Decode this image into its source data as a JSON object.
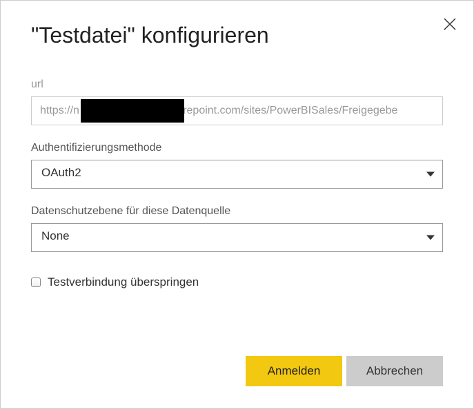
{
  "dialog": {
    "title": "\"Testdatei\" konfigurieren"
  },
  "fields": {
    "url": {
      "label": "url",
      "value": "https://n                            sharepoint.com/sites/PowerBISales/Freigegebe"
    },
    "auth": {
      "label": "Authentifizierungsmethode",
      "selected": "OAuth2"
    },
    "privacy": {
      "label": "Datenschutzebene für diese Datenquelle",
      "selected": "None"
    },
    "skip_test": {
      "label": "Testverbindung überspringen"
    }
  },
  "buttons": {
    "primary": "Anmelden",
    "secondary": "Abbrechen"
  },
  "colors": {
    "accent": "#F2C811"
  }
}
